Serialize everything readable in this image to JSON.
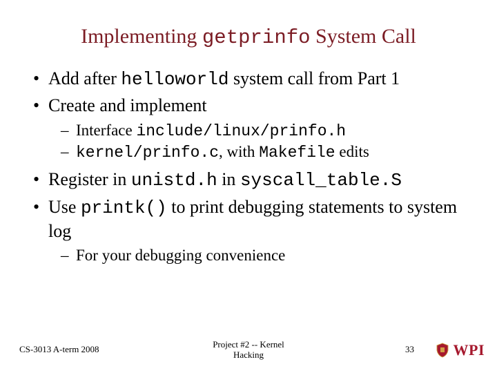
{
  "title": {
    "pre": "Implementing ",
    "code": "getprinfo",
    "post": " System Call"
  },
  "bullets": {
    "b1": {
      "pre": "Add after ",
      "code": "helloworld",
      "post": " system call from Part 1"
    },
    "b2": {
      "text": "Create and implement"
    },
    "b2s1": {
      "pre": "Interface ",
      "code": "include/linux/prinfo.h"
    },
    "b2s2": {
      "code1": "kernel/prinfo.c",
      "mid": ", with ",
      "code2": "Makefile",
      "post": " edits"
    },
    "b3": {
      "pre": "Register in ",
      "code1": "unistd.h",
      "mid": " in ",
      "code2": "syscall_table.S"
    },
    "b4": {
      "pre": "Use ",
      "code": "printk()",
      "post": " to print debugging statements to system log"
    },
    "b4s1": {
      "text": "For your debugging convenience"
    }
  },
  "footer": {
    "left": "CS-3013 A-term 2008",
    "center": "Project #2 -- Kernel\nHacking",
    "page": "33",
    "logo_text": "WPI"
  }
}
